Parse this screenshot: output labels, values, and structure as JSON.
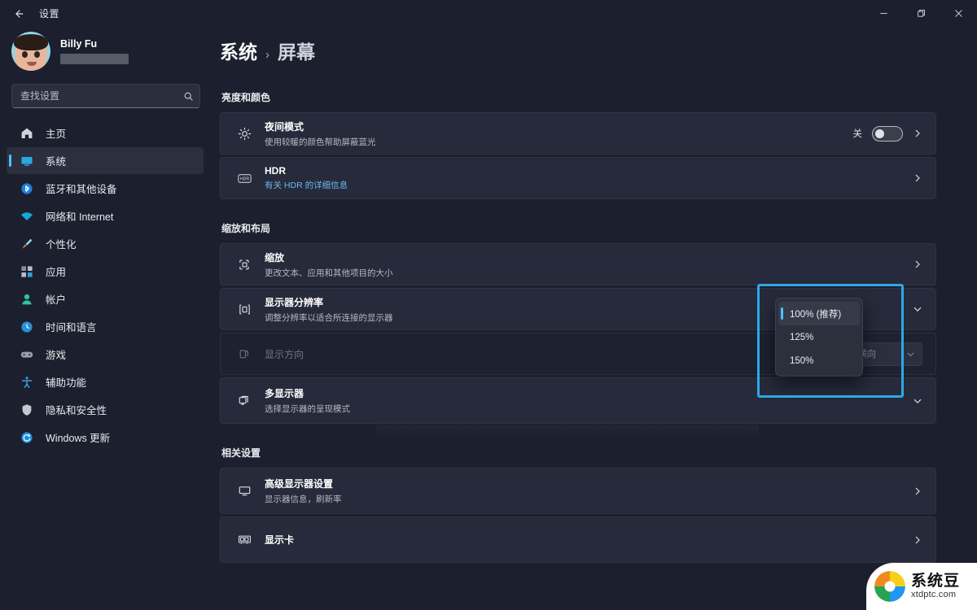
{
  "window": {
    "title": "设置",
    "back_icon": "arrow-left-icon",
    "controls": {
      "minimize": "minimize-icon",
      "restore": "restore-icon",
      "close": "close-icon"
    }
  },
  "sidebar": {
    "profile": {
      "name": "Billy Fu",
      "email_redacted": true
    },
    "search": {
      "placeholder": "查找设置",
      "value": "",
      "icon": "search-icon"
    },
    "items": [
      {
        "label": "主页",
        "icon": "home-icon",
        "active": false
      },
      {
        "label": "系统",
        "icon": "monitor-icon",
        "active": true
      },
      {
        "label": "蓝牙和其他设备",
        "icon": "bluetooth-icon",
        "active": false
      },
      {
        "label": "网络和 Internet",
        "icon": "wifi-icon",
        "active": false
      },
      {
        "label": "个性化",
        "icon": "brush-icon",
        "active": false
      },
      {
        "label": "应用",
        "icon": "apps-icon",
        "active": false
      },
      {
        "label": "帐户",
        "icon": "account-icon",
        "active": false
      },
      {
        "label": "时间和语言",
        "icon": "clock-icon",
        "active": false
      },
      {
        "label": "游戏",
        "icon": "gamepad-icon",
        "active": false
      },
      {
        "label": "辅助功能",
        "icon": "accessibility-icon",
        "active": false
      },
      {
        "label": "隐私和安全性",
        "icon": "shield-icon",
        "active": false
      },
      {
        "label": "Windows 更新",
        "icon": "update-icon",
        "active": false
      }
    ]
  },
  "main": {
    "breadcrumb": {
      "root": "系统",
      "separator": "›",
      "current": "屏幕"
    },
    "sections": [
      {
        "title": "亮度和颜色",
        "rows": [
          {
            "title": "夜间模式",
            "sub": "使用较暖的颜色帮助屏蔽蓝光",
            "icon": "brightness-icon",
            "toggle_label": "关",
            "toggle_on": false,
            "chevron": "chevron-right-icon"
          },
          {
            "title": "HDR",
            "sub": "有关 HDR 的详细信息",
            "sub_is_link": true,
            "icon": "hdr-icon",
            "chevron": "chevron-right-icon"
          }
        ]
      },
      {
        "title": "缩放和布局",
        "rows": [
          {
            "title": "缩放",
            "sub": "更改文本、应用和其他项目的大小",
            "icon": "scale-icon",
            "chevron": "chevron-right-icon"
          },
          {
            "title": "显示器分辨率",
            "sub": "调整分辨率以适合所连接的显示器",
            "icon": "resolution-icon",
            "chevron": "chevron-down-icon"
          },
          {
            "title": "显示方向",
            "sub": "",
            "icon": "orientation-icon",
            "disabled": true,
            "combo_value": "横向",
            "chevron": "chevron-down-icon"
          },
          {
            "title": "多显示器",
            "sub": "选择显示器的呈现模式",
            "icon": "multi-monitor-icon",
            "chevron": "chevron-down-icon"
          }
        ]
      },
      {
        "title": "相关设置",
        "rows": [
          {
            "title": "高级显示器设置",
            "sub": "显示器信息，刷新率",
            "icon": "display-advanced-icon",
            "chevron": "chevron-right-icon"
          },
          {
            "title": "显示卡",
            "sub": "",
            "icon": "graphics-card-icon",
            "chevron": "chevron-right-icon"
          }
        ]
      }
    ],
    "scale_dropdown": {
      "open": true,
      "highlighted": true,
      "highlight_color": "#2ea7e8",
      "accent_color": "#4cc2ff",
      "options": [
        {
          "label": "100% (推荐)",
          "selected": true
        },
        {
          "label": "125%",
          "selected": false
        },
        {
          "label": "150%",
          "selected": false
        }
      ]
    }
  },
  "watermark": {
    "title": "系统豆",
    "url": "xtdptc.com"
  }
}
